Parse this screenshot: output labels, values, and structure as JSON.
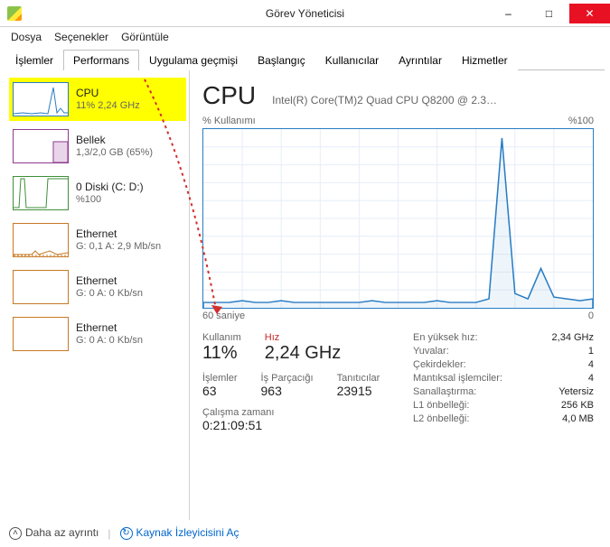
{
  "window": {
    "title": "Görev Yöneticisi"
  },
  "menu": {
    "file": "Dosya",
    "options": "Seçenekler",
    "view": "Görüntüle"
  },
  "tabs": {
    "processes": "İşlemler",
    "performance": "Performans",
    "appHistory": "Uygulama geçmişi",
    "startup": "Başlangıç",
    "users": "Kullanıcılar",
    "details": "Ayrıntılar",
    "services": "Hizmetler"
  },
  "sidebar": [
    {
      "title": "CPU",
      "sub": "11% 2,24 GHz",
      "color": "#287dc5"
    },
    {
      "title": "Bellek",
      "sub": "1,3/2,0 GB (65%)",
      "color": "#8e3a8e"
    },
    {
      "title": "0 Diski (C: D:)",
      "sub": "%100",
      "color": "#3f8f3a"
    },
    {
      "title": "Ethernet",
      "sub": "G: 0,1 A: 2,9 Mb/sn",
      "color": "#c77a24"
    },
    {
      "title": "Ethernet",
      "sub": "G: 0 A: 0 Kb/sn",
      "color": "#c77a24"
    },
    {
      "title": "Ethernet",
      "sub": "G: 0 A: 0 Kb/sn",
      "color": "#c77a24"
    }
  ],
  "detail": {
    "title": "CPU",
    "model": "Intel(R) Core(TM)2 Quad CPU Q8200 @ 2.3…",
    "chartTopLeft": "% Kullanımı",
    "chartTopRight": "%100",
    "chartBottomLeft": "60 saniye",
    "chartBottomRight": "0",
    "labels": {
      "usage": "Kullanım",
      "speed": "Hız",
      "processes": "İşlemler",
      "threads": "İş Parçacığı",
      "handles": "Tanıtıcılar",
      "uptime": "Çalışma zamanı",
      "maxSpeed": "En yüksek hız:",
      "sockets": "Yuvalar:",
      "cores": "Çekirdekler:",
      "logical": "Mantıksal işlemciler:",
      "virt": "Sanallaştırma:",
      "l1": "L1 önbelleği:",
      "l2": "L2 önbelleği:"
    },
    "values": {
      "usage": "11%",
      "speed": "2,24 GHz",
      "processes": "63",
      "threads": "963",
      "handles": "23915",
      "uptime": "0:21:09:51",
      "maxSpeed": "2,34 GHz",
      "sockets": "1",
      "cores": "4",
      "logical": "4",
      "virt": "Yetersiz",
      "l1": "256 KB",
      "l2": "4,0 MB"
    }
  },
  "footer": {
    "fewer": "Daha az ayrıntı",
    "resmon": "Kaynak İzleyicisini Aç"
  },
  "chart_data": {
    "type": "line",
    "title": "% Kullanımı",
    "xlabel": "60 saniye",
    "ylabel": "% Kullanımı",
    "ylim": [
      0,
      100
    ],
    "x_seconds_ago": [
      60,
      58,
      56,
      54,
      52,
      50,
      48,
      46,
      44,
      42,
      40,
      38,
      36,
      34,
      32,
      30,
      28,
      26,
      24,
      22,
      20,
      18,
      16,
      14,
      12,
      10,
      8,
      6,
      4,
      2,
      0
    ],
    "values": [
      3,
      3,
      3,
      4,
      3,
      3,
      4,
      3,
      3,
      3,
      3,
      3,
      3,
      4,
      3,
      3,
      3,
      3,
      4,
      3,
      3,
      3,
      5,
      95,
      8,
      5,
      22,
      6,
      5,
      4,
      5
    ]
  }
}
